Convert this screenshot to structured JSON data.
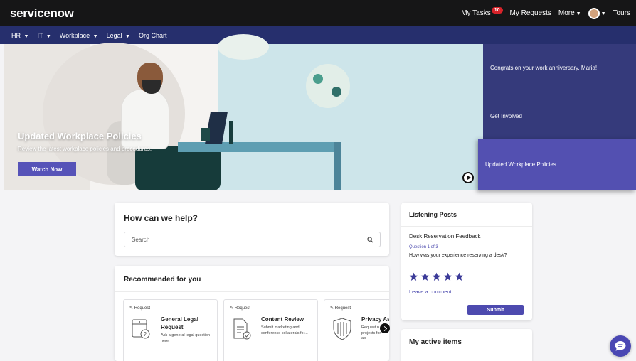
{
  "topbar": {
    "logo": "servicenow",
    "my_tasks": "My Tasks",
    "tasks_count": "10",
    "my_requests": "My Requests",
    "more": "More",
    "tours": "Tours"
  },
  "subnav": {
    "items": [
      "HR",
      "IT",
      "Workplace",
      "Legal",
      "Org Chart"
    ]
  },
  "hero": {
    "title": "Updated Workplace Policies",
    "subtitle": "Review the latest workplace policies and procedures.",
    "button": "Watch Now"
  },
  "slides": [
    "Congrats on your work anniversary, Maria!",
    "Get Involved",
    "Updated Workplace Policies"
  ],
  "help": {
    "title": "How can we help?",
    "search_placeholder": "Search"
  },
  "recommended": {
    "title": "Recommended for you",
    "tiles": [
      {
        "tag": "Request",
        "name": "General Legal Request",
        "desc": "Ask a general legal question here."
      },
      {
        "tag": "Request",
        "name": "Content Review",
        "desc": "Submit marketing and conference collaterals for..."
      },
      {
        "tag": "Request",
        "name": "Privacy Ass",
        "desc": "Request n projects for ap"
      }
    ]
  },
  "listening": {
    "title": "Listening Posts",
    "subtitle": "Desk Reservation Feedback",
    "question_counter": "Question 1 of 3",
    "question": "How was your experience reserving a desk?",
    "rating": 5,
    "leave_comment": "Leave a comment",
    "submit": "Submit"
  },
  "active_items": {
    "title": "My active items"
  },
  "colors": {
    "topbar": "#161617",
    "subnav": "#262f6d",
    "accent": "#5653b8",
    "slide": "#353a7b",
    "slide_active": "#5350b1"
  }
}
